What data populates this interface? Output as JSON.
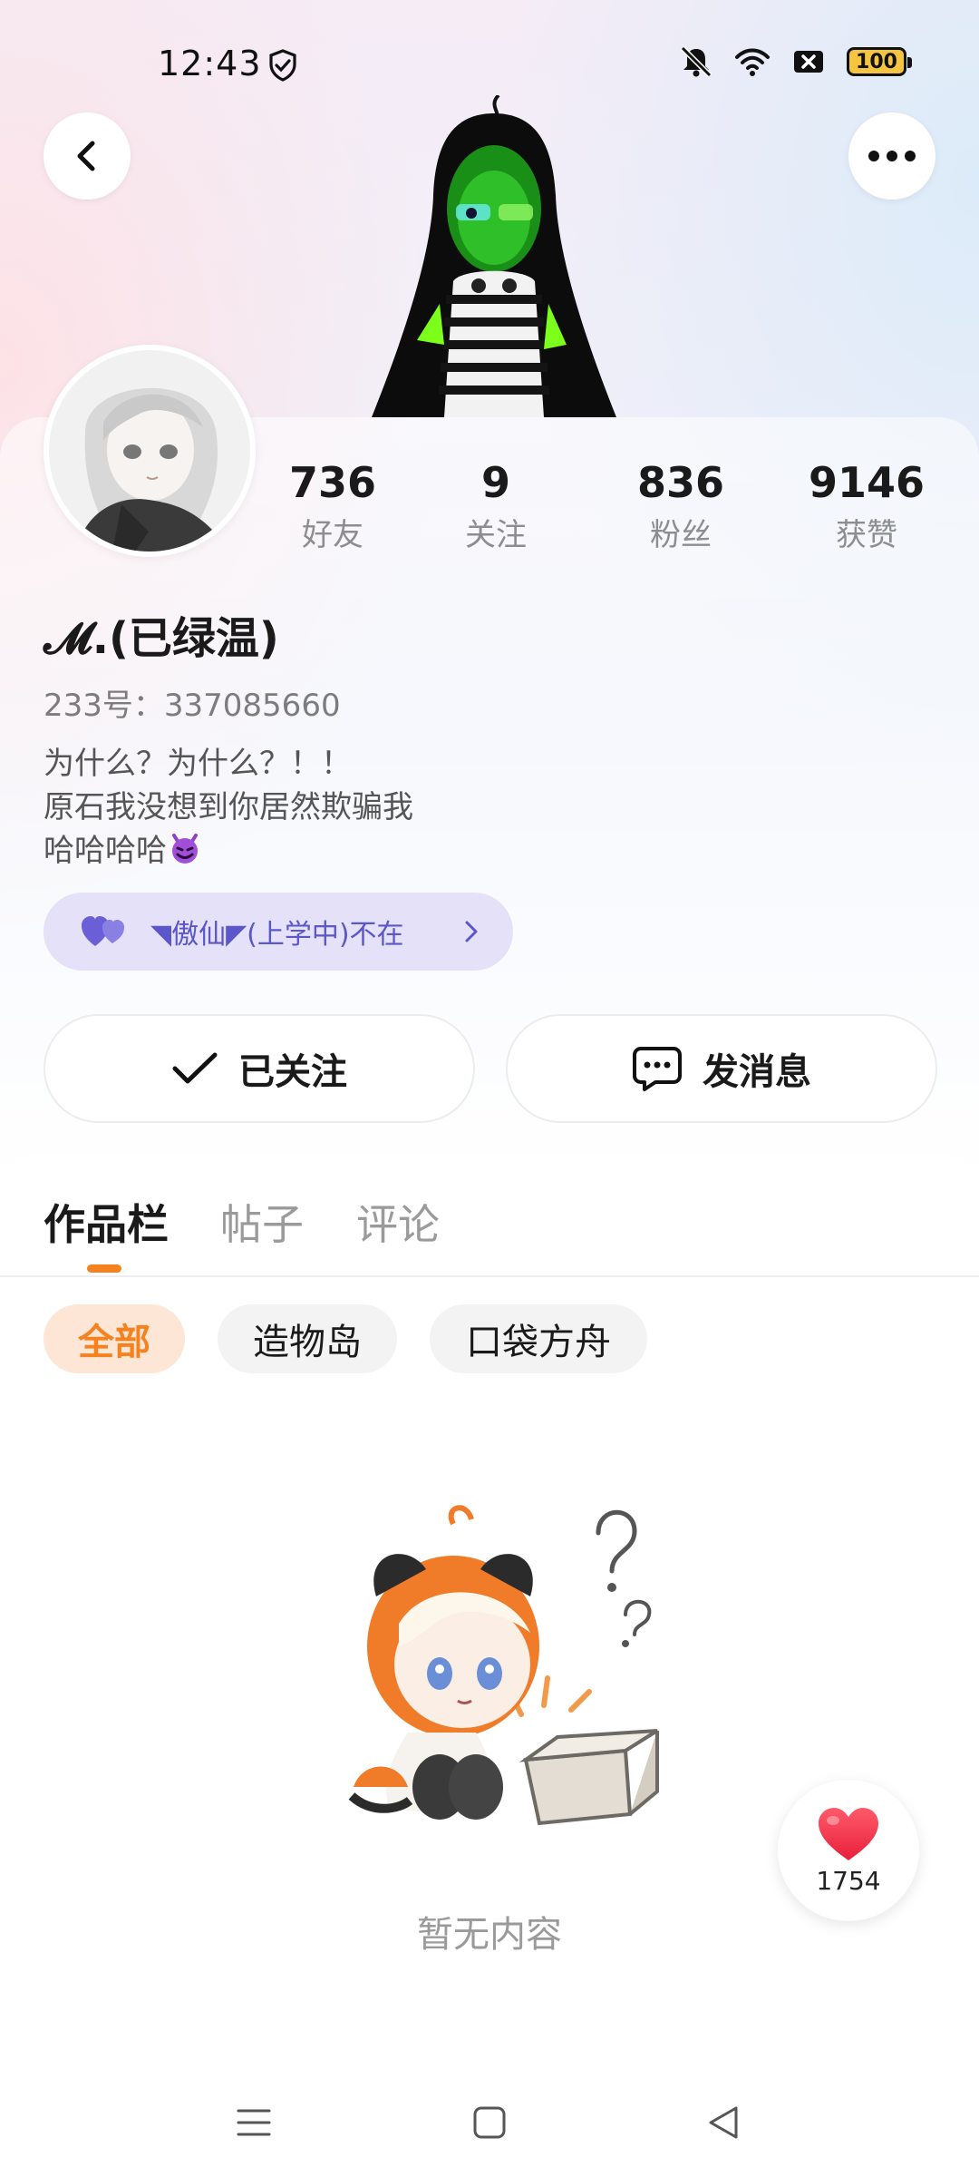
{
  "status_bar": {
    "time": "12:43",
    "battery": "100",
    "icons": [
      "shield-check-icon",
      "mute-bell-icon",
      "wifi-icon",
      "data-off-icon",
      "battery-icon"
    ]
  },
  "header": {
    "back_icon": "chevron-left-icon",
    "more_icon": "more-horizontal-icon"
  },
  "profile": {
    "stats": [
      {
        "value": "736",
        "label": "好友"
      },
      {
        "value": "9",
        "label": "关注"
      },
      {
        "value": "836",
        "label": "粉丝"
      },
      {
        "value": "9146",
        "label": "获赞"
      }
    ],
    "username": "𝓜.(已绿温)",
    "uid": "233号：337085660",
    "bio_lines": [
      "为什么？为什么？！！",
      "原石我没想到你居然欺骗我",
      "哈哈哈哈"
    ],
    "bio_emoji_icon": "smiling-devil-icon",
    "guild": "◥傲仙◤(上学中)不在",
    "follow_label": "已关注",
    "message_label": "发消息"
  },
  "tabs": [
    {
      "label": "作品栏",
      "active": true
    },
    {
      "label": "帖子",
      "active": false
    },
    {
      "label": "评论",
      "active": false
    }
  ],
  "filters": [
    {
      "label": "全部",
      "active": true
    },
    {
      "label": "造物岛",
      "active": false
    },
    {
      "label": "口袋方舟",
      "active": false
    }
  ],
  "empty_state": {
    "text": "暂无内容"
  },
  "like_fab": {
    "count": "1754",
    "icon": "heart-icon"
  },
  "nav_bar": {
    "icons": [
      "menu-icon",
      "home-square-icon",
      "back-triangle-icon"
    ]
  },
  "colors": {
    "accent": "#f5821f",
    "guild_text": "#5b56c9",
    "guild_bg": "#e4e1f8",
    "heart": "#f0334a"
  }
}
